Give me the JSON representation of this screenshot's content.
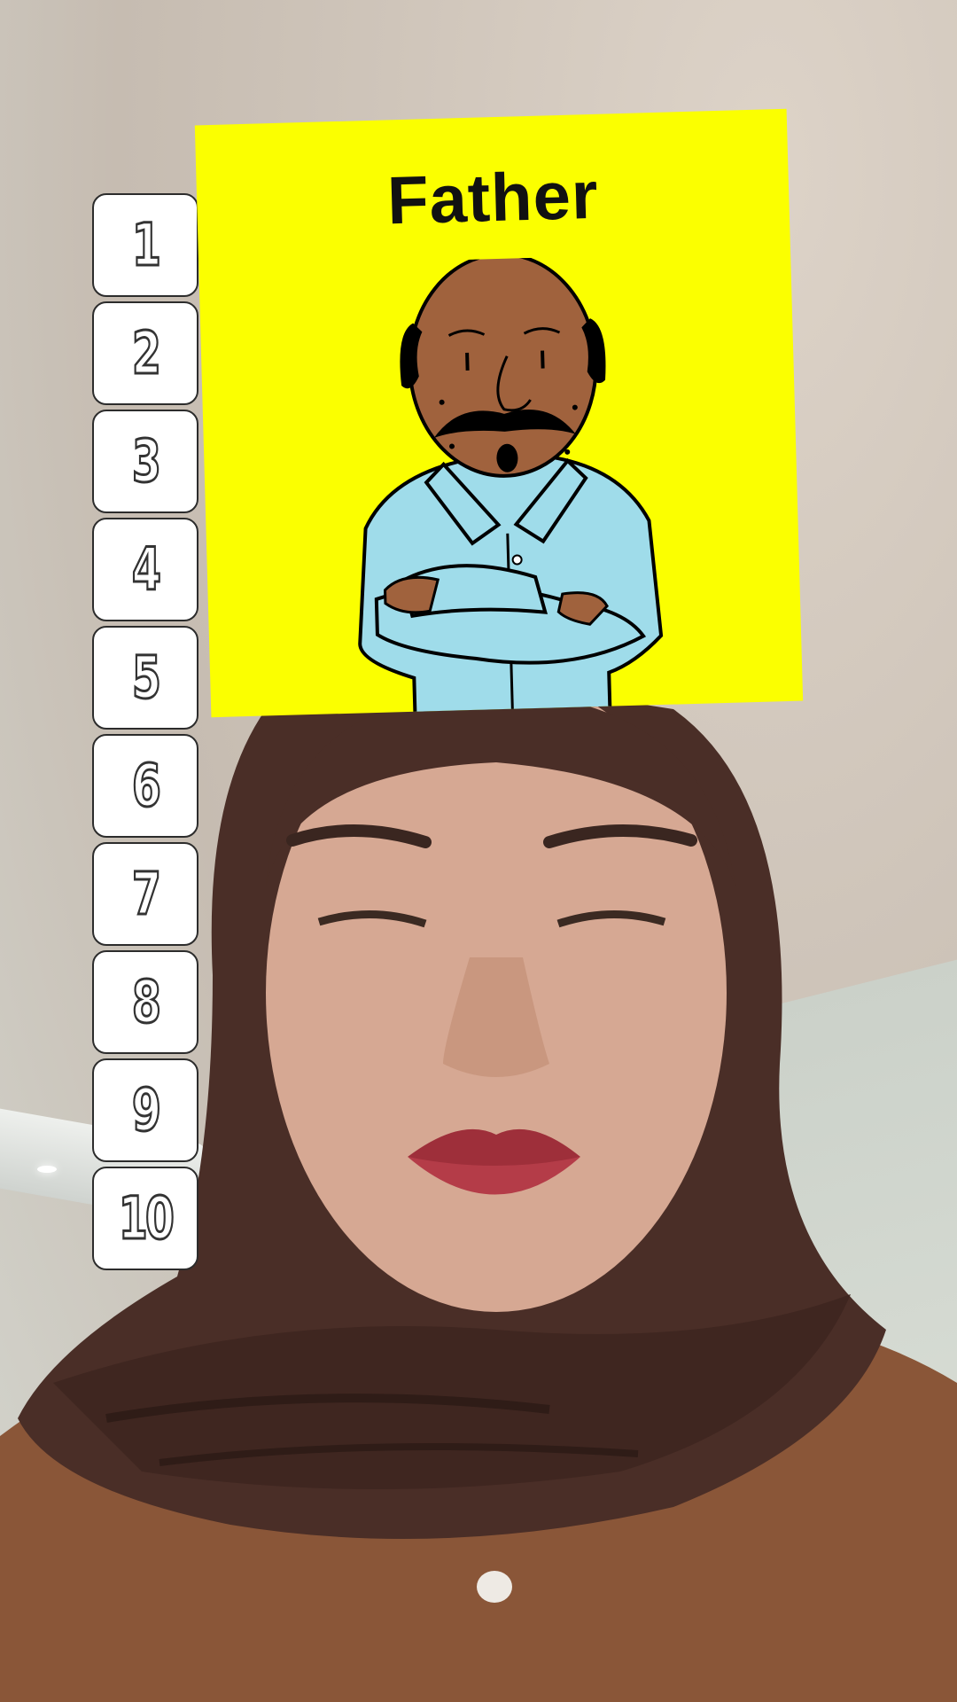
{
  "card": {
    "title": "Father",
    "background_color": "#fbff00",
    "illustration": "father-cartoon"
  },
  "ranking_slots": [
    {
      "label": "1"
    },
    {
      "label": "2"
    },
    {
      "label": "3"
    },
    {
      "label": "4"
    },
    {
      "label": "5"
    },
    {
      "label": "6"
    },
    {
      "label": "7"
    },
    {
      "label": "8"
    },
    {
      "label": "9"
    },
    {
      "label": "10"
    }
  ],
  "colors": {
    "tile_background": "#ffffff",
    "tile_border": "#2c2c2c",
    "hijab": "#4a2e27",
    "shirt": "#8a5638"
  }
}
